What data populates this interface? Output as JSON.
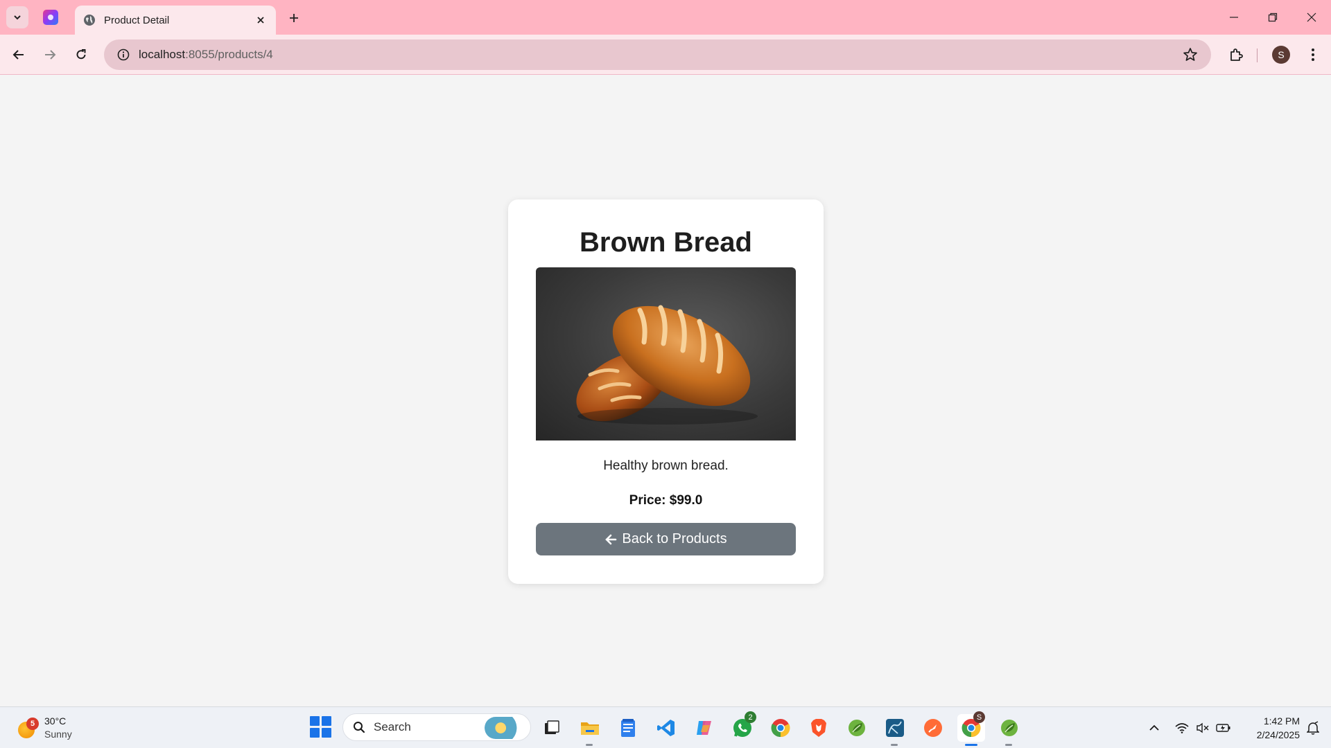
{
  "browser": {
    "tab_title": "Product Detail",
    "url_host": "localhost",
    "url_path": ":8055/products/4",
    "profile_initial": "S"
  },
  "product": {
    "name": "Brown Bread",
    "description": "Healthy brown bread.",
    "price_label": "Price: $99.0",
    "image_subject": "brown-bread-loaves-photo"
  },
  "actions": {
    "back_label": "Back to Products"
  },
  "taskbar": {
    "weather": {
      "temp": "30°C",
      "condition": "Sunny",
      "badge": "5"
    },
    "search_label": "Search",
    "apps": [
      {
        "name": "task-view",
        "icon": "task-view-icon"
      },
      {
        "name": "file-explorer",
        "icon": "folder-icon"
      },
      {
        "name": "notepad",
        "icon": "notepad-icon"
      },
      {
        "name": "vscode",
        "icon": "vscode-icon"
      },
      {
        "name": "copilot",
        "icon": "copilot-icon"
      },
      {
        "name": "whatsapp",
        "icon": "whatsapp-icon",
        "badge": "2"
      },
      {
        "name": "chrome",
        "icon": "chrome-icon"
      },
      {
        "name": "brave",
        "icon": "brave-icon"
      },
      {
        "name": "spring-tool",
        "icon": "spring-leaf-icon"
      },
      {
        "name": "mysql-workbench",
        "icon": "mysql-icon"
      },
      {
        "name": "postman",
        "icon": "postman-icon"
      },
      {
        "name": "chrome-profile",
        "icon": "chrome-icon",
        "badge": "S"
      },
      {
        "name": "spring-tool-2",
        "icon": "spring-leaf-icon"
      }
    ],
    "clock": {
      "time": "1:42 PM",
      "date": "2/24/2025"
    }
  },
  "colors": {
    "tabstrip": "#ffb4c2",
    "toolbar": "#fce8ec",
    "page_bg": "#f4f4f4",
    "button_bg": "#6c757d"
  }
}
